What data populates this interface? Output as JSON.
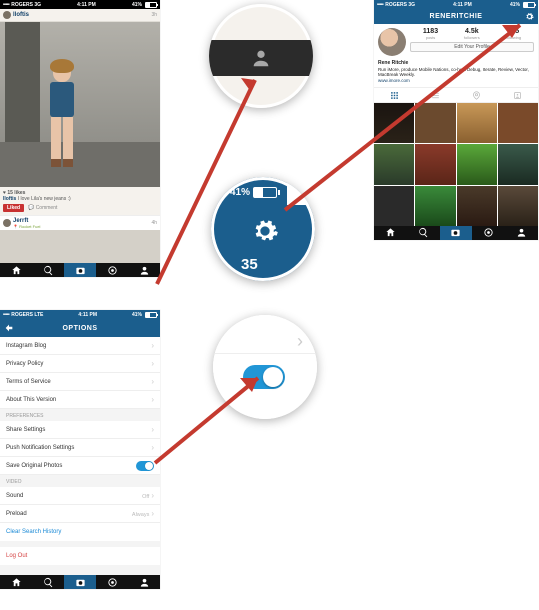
{
  "s1": {
    "status": {
      "carrier": "ROGERS  3G",
      "time": "4:11 PM",
      "battery": "41%"
    },
    "post1": {
      "user": "lloftis",
      "time": "3h",
      "likes": "♥ 15 likes",
      "caption": "I love Lila's new jeans :)",
      "liked_label": "Liked",
      "comment_label": "Comment"
    },
    "post2": {
      "user": "Jerrft",
      "location": "📍 Rocket Fuel",
      "time": "4h"
    }
  },
  "s2": {
    "status": {
      "carrier": "ROGERS  3G",
      "time": "4:11 PM",
      "battery": "41%"
    },
    "title": "RENERITCHIE",
    "stats": {
      "posts": {
        "n": "1183",
        "l": "posts"
      },
      "followers": {
        "n": "4.5k",
        "l": "followers"
      },
      "following": {
        "n": "205",
        "l": "following"
      }
    },
    "edit_label": "Edit Your Profile",
    "bio": {
      "name": "Rene Ritchie",
      "text": "Run iMore, produce Mobile Nations, co-host Debug, Iterate, Review, Vector, MacBreak Weekly.",
      "link": "www.imore.com"
    }
  },
  "s3": {
    "status": {
      "carrier": "ROGERS  LTE",
      "time": "4:11 PM",
      "battery": "41%"
    },
    "title": "OPTIONS",
    "rows": [
      "Instagram Blog",
      "Privacy Policy",
      "Terms of Service",
      "About This Version",
      "Share Settings",
      "Push Notification Settings",
      "Save Original Photos",
      "Sound",
      "Preload"
    ],
    "sect_pref": "Preferences",
    "sect_video": "Video",
    "sound_val": "Off",
    "preload_val": "Always",
    "clear": "Clear Search History",
    "logout": "Log Out"
  },
  "c2": {
    "battery": "41%",
    "num": "35"
  }
}
